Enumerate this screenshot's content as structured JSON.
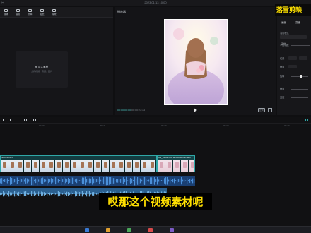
{
  "app": {
    "title": "2023.01.13 10:00"
  },
  "media_toolbar": [
    {
      "key": "media",
      "label": "媒体"
    },
    {
      "key": "audio",
      "label": "音频"
    },
    {
      "key": "text",
      "label": "文本"
    },
    {
      "key": "sticker",
      "label": "贴纸"
    },
    {
      "key": "effects",
      "label": "特效"
    }
  ],
  "import": {
    "label": "导入素材",
    "hint": "支持视频、音频、图片"
  },
  "player": {
    "title": "播放器",
    "current_time": "00:00:00:00",
    "duration": "00:00:23:13",
    "ratio_label": "比例"
  },
  "watermark": "落雪剪映",
  "inspector": {
    "tabs": [
      "画面",
      "变速"
    ],
    "rows": [
      {
        "label": "混合模式",
        "value": "正常"
      },
      {
        "label": "不透明度",
        "value": ""
      },
      {
        "label": "位置",
        "value": ""
      },
      {
        "label": "缩放",
        "value": ""
      },
      {
        "label": "旋转",
        "value": ""
      },
      {
        "label": "缩放",
        "value": ""
      },
      {
        "label": "亮度",
        "value": ""
      }
    ]
  },
  "timeline": {
    "ruler": [
      "00:00",
      "00:10",
      "00:20",
      "00:30",
      "00:40",
      "00:50"
    ],
    "clip_a_label": "4bf8c9f4115",
    "clip_b_label": "8f9_5340b5057aff3b6b9e6aff7a8b",
    "subtitle": "哎那这个视频素材呢"
  },
  "colors": {
    "accent": "#2fa8a7",
    "subtitle": "#ffe000",
    "watermark": "#ffe100"
  }
}
